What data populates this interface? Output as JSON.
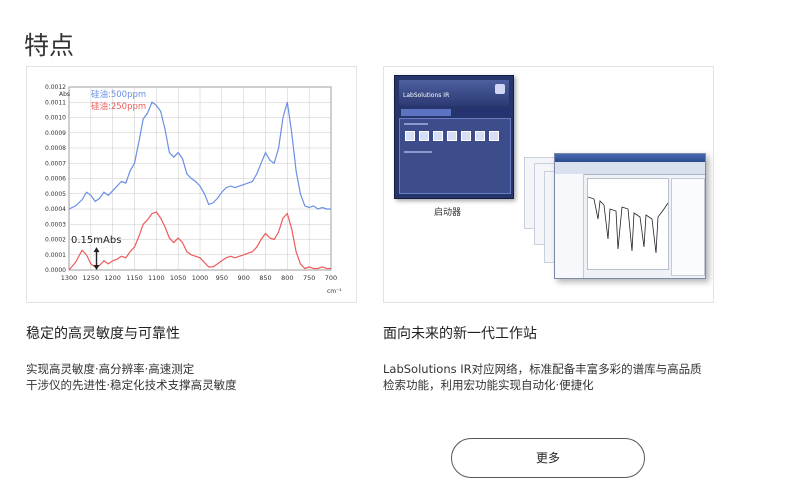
{
  "page": {
    "title": "特点"
  },
  "card1": {
    "title": "稳定的高灵敏度与可靠性",
    "desc": [
      "实现高灵敏度·高分辨率·高速测定",
      "干涉仪的先进性·稳定化技术支撑高灵敏度"
    ]
  },
  "card2": {
    "title": "面向未来的新一代工作站",
    "desc": [
      "LabSolutions IR对应网络，标准配备丰富多彩的谱库与高品质",
      "检索功能，利用宏功能实现自动化·便捷化"
    ],
    "launcher_caption": "启动器",
    "launcher_name": "LabSolutions IR"
  },
  "more_button": {
    "label": "更多"
  },
  "colors": {
    "series_500": "#6a8fe3",
    "series_250": "#ee5b5b",
    "annotation": "#222222"
  },
  "chart_data": {
    "type": "line",
    "ylabel": "Abs",
    "xlabel": "cm⁻¹",
    "xlim": [
      1300,
      700
    ],
    "ylim": [
      0,
      0.0012
    ],
    "x_ticks": [
      1300,
      1250,
      1200,
      1150,
      1100,
      1050,
      1000,
      950,
      900,
      850,
      800,
      750,
      700
    ],
    "y_ticks": [
      "0.0000",
      "0.0001",
      "0.0002",
      "0.0003",
      "0.0004",
      "0.0005",
      "0.0006",
      "0.0007",
      "0.0008",
      "0.0009",
      "0.0010",
      "0.0011",
      "0.0012"
    ],
    "grid": true,
    "legend": [
      {
        "label": "硅油:500ppm"
      },
      {
        "label": "硅油:250ppm"
      }
    ],
    "annotation": "0.15mAbs",
    "series": [
      {
        "name": "硅油:500ppm",
        "x": [
          1300,
          1285,
          1270,
          1260,
          1250,
          1240,
          1230,
          1220,
          1210,
          1200,
          1190,
          1180,
          1170,
          1160,
          1150,
          1140,
          1130,
          1120,
          1110,
          1100,
          1090,
          1080,
          1070,
          1060,
          1050,
          1040,
          1030,
          1020,
          1010,
          1000,
          990,
          980,
          970,
          960,
          950,
          940,
          930,
          920,
          910,
          900,
          890,
          880,
          870,
          860,
          850,
          840,
          830,
          820,
          810,
          800,
          790,
          780,
          770,
          760,
          750,
          740,
          730,
          720,
          710,
          700
        ],
        "values": [
          0.0004,
          0.00042,
          0.00046,
          0.00051,
          0.00049,
          0.00045,
          0.00047,
          0.00051,
          0.00049,
          0.00052,
          0.00055,
          0.00058,
          0.00057,
          0.00065,
          0.0007,
          0.00084,
          0.00099,
          0.00103,
          0.0011,
          0.00108,
          0.00104,
          0.00092,
          0.00077,
          0.00074,
          0.00077,
          0.00073,
          0.00063,
          0.0006,
          0.00058,
          0.00055,
          0.0005,
          0.00043,
          0.00044,
          0.00047,
          0.00051,
          0.00054,
          0.00055,
          0.00054,
          0.00055,
          0.00056,
          0.00057,
          0.00058,
          0.00063,
          0.0007,
          0.00077,
          0.00072,
          0.0007,
          0.0008,
          0.001,
          0.0011,
          0.0009,
          0.00065,
          0.0005,
          0.00042,
          0.00041,
          0.00042,
          0.0004,
          0.00041,
          0.0004,
          0.0004
        ]
      },
      {
        "name": "硅油:250ppm",
        "x": [
          1300,
          1285,
          1270,
          1260,
          1250,
          1240,
          1230,
          1220,
          1210,
          1200,
          1190,
          1180,
          1170,
          1160,
          1150,
          1140,
          1130,
          1120,
          1110,
          1100,
          1090,
          1080,
          1070,
          1060,
          1050,
          1040,
          1030,
          1020,
          1010,
          1000,
          990,
          980,
          970,
          960,
          950,
          940,
          930,
          920,
          910,
          900,
          890,
          880,
          870,
          860,
          850,
          840,
          830,
          820,
          810,
          800,
          790,
          780,
          770,
          760,
          750,
          740,
          730,
          720,
          710,
          700
        ],
        "values": [
          0.0,
          5e-05,
          0.00013,
          0.0001,
          4e-05,
          2e-05,
          3e-05,
          6e-05,
          4e-05,
          6e-05,
          7e-05,
          9e-05,
          8e-05,
          0.00012,
          0.00015,
          0.00022,
          0.0003,
          0.00033,
          0.00037,
          0.00038,
          0.00034,
          0.00028,
          0.00021,
          0.00018,
          0.00021,
          0.00018,
          0.00012,
          0.0001,
          9e-05,
          8e-05,
          5e-05,
          2e-05,
          2e-05,
          4e-05,
          6e-05,
          8e-05,
          9e-05,
          8e-05,
          9e-05,
          0.0001,
          0.00011,
          0.00012,
          0.00015,
          0.0002,
          0.00024,
          0.00021,
          0.0002,
          0.00025,
          0.00034,
          0.00037,
          0.00027,
          0.00012,
          4e-05,
          1e-05,
          2e-05,
          1e-05,
          1e-05,
          2e-05,
          1e-05,
          1e-05
        ]
      }
    ]
  }
}
